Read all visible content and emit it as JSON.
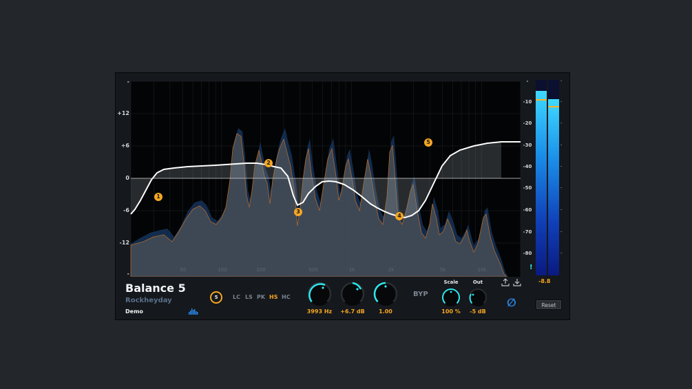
{
  "plugin": {
    "name": "Balance 5",
    "vendor": "Rockheyday",
    "license": "Demo"
  },
  "eq": {
    "db_labels": [
      "-",
      "+12",
      "+6",
      "0",
      "-6",
      "-12",
      "-"
    ],
    "freq_labels": [
      "50",
      "100",
      "200",
      "500",
      "1k",
      "2k",
      "5k",
      "10k"
    ],
    "bands": [
      {
        "id": "1",
        "label": "1"
      },
      {
        "id": "2",
        "label": "2"
      },
      {
        "id": "3",
        "label": "3"
      },
      {
        "id": "4",
        "label": "4"
      },
      {
        "id": "5",
        "label": "5"
      }
    ]
  },
  "controls": {
    "band_selector": "5",
    "filter_types": [
      "LC",
      "LS",
      "PK",
      "HS",
      "HC"
    ],
    "active_filter": "HS",
    "frequency": "3993 Hz",
    "gain": "+6.7 dB",
    "q": "1.00",
    "bypass_label": "BYP",
    "scale_title": "Scale",
    "scale_value": "100 %",
    "out_title": "Out",
    "out_value": "-5 dB",
    "reset_label": "Reset",
    "phase_symbol": "∅"
  },
  "meter": {
    "scale": [
      "-",
      "-10",
      "-20",
      "-30",
      "-40",
      "-50",
      "-60",
      "-70",
      "-80",
      "!"
    ],
    "readout": "-8.8",
    "left_level_db": -5,
    "right_level_db": -8.8,
    "left_peak_db": -9,
    "right_peak_db": -12
  },
  "colors": {
    "accent": "#f5a623",
    "cyan": "#2ee8f0",
    "blue": "#2a8cf0",
    "background": "#15181c"
  }
}
